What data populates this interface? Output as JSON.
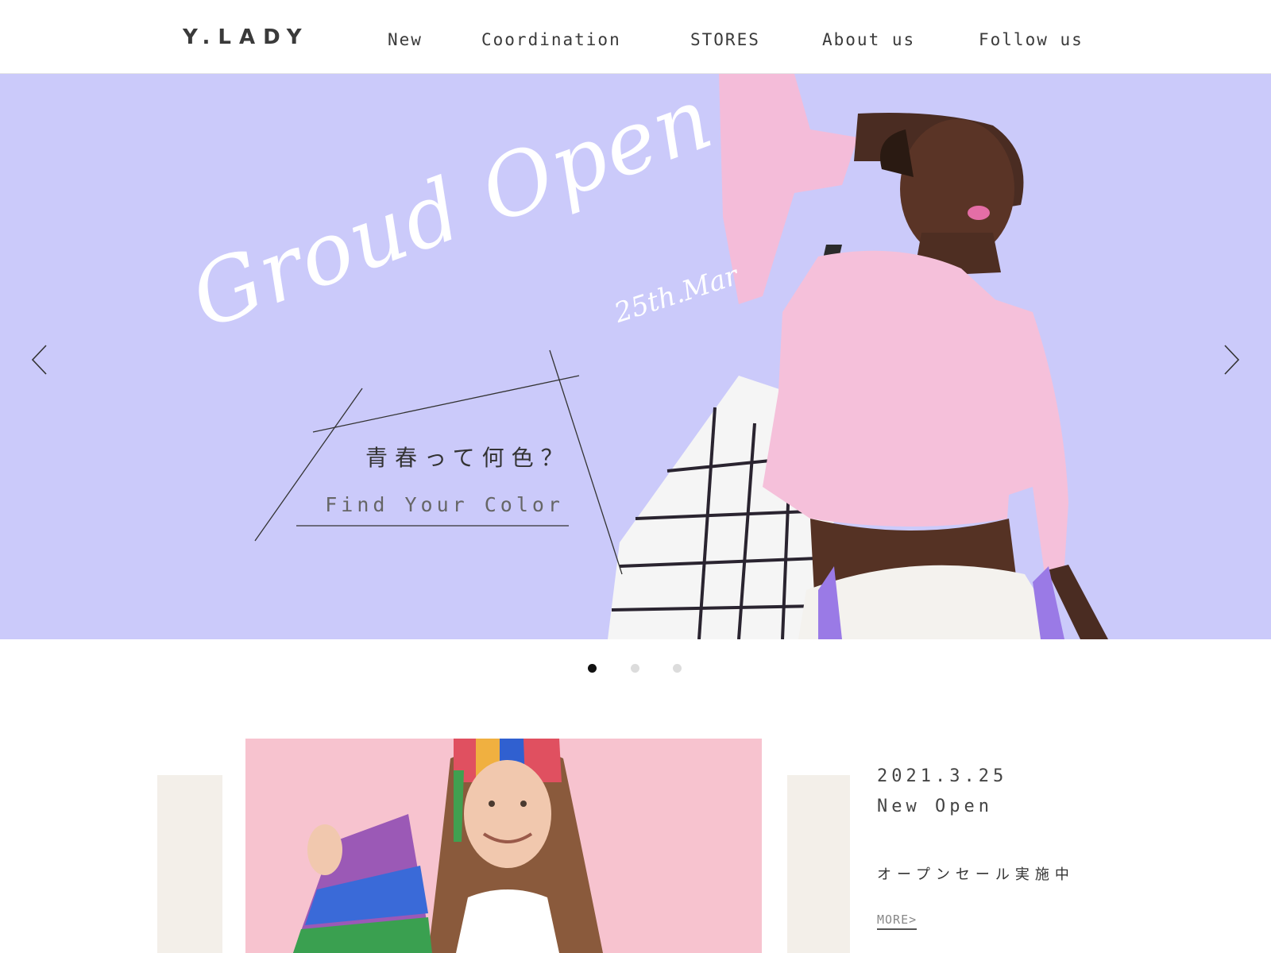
{
  "header": {
    "logo": "Y.LADY",
    "nav": [
      "New",
      "Coordination",
      "STORES",
      "About us",
      "Follow us"
    ]
  },
  "hero": {
    "title": "Groud Open",
    "date": "25th.Mar",
    "tagline_jp": "青春って何色？",
    "tagline_en": "Find Your Color",
    "background_color": "#cbcafa",
    "prev_icon": "chevron-left-icon",
    "next_icon": "chevron-right-icon"
  },
  "carousel": {
    "slide_count": 3,
    "active_index": 0
  },
  "news": {
    "date": "2021.3.25",
    "title": "New Open",
    "description": "オープンセール実施中",
    "more_label": "MORE>"
  },
  "colors": {
    "accent_beige": "#f3efe9",
    "photo_pink": "#f7c3cf"
  }
}
